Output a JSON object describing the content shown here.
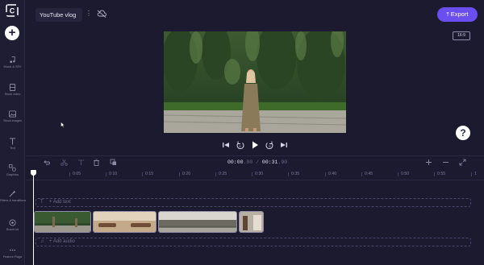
{
  "app": {
    "accent": "#6b4ef0",
    "background": "#1b1a2e"
  },
  "sidebar": {
    "items": [
      {
        "label": "Music & SFX",
        "icon": "music-note-icon"
      },
      {
        "label": "Stock video",
        "icon": "film-icon"
      },
      {
        "label": "Stock images",
        "icon": "image-icon"
      },
      {
        "label": "Text",
        "icon": "text-icon"
      },
      {
        "label": "Graphics",
        "icon": "shapes-icon"
      },
      {
        "label": "Filters & transitions",
        "icon": "magic-wand-icon"
      },
      {
        "label": "Brand kit",
        "icon": "brand-icon"
      },
      {
        "label": "Feature Flags",
        "icon": "more-icon"
      }
    ]
  },
  "header": {
    "project_title": "YouTube vlog",
    "export_label": "Export"
  },
  "preview": {
    "aspect_ratio": "16:9"
  },
  "timeline": {
    "current_time": "00:00",
    "current_frac": ".00",
    "separator": " / ",
    "total_time": "00:31",
    "total_frac": ".90",
    "ticks": [
      "0:05",
      "0:10",
      "0:15",
      "0:20",
      "0:25",
      "0:30",
      "0:35",
      "0:40",
      "0:45",
      "0:50",
      "0:55",
      "1"
    ],
    "add_text_label": "+ Add text",
    "add_audio_label": "+ Add audio"
  },
  "help_label": "?"
}
